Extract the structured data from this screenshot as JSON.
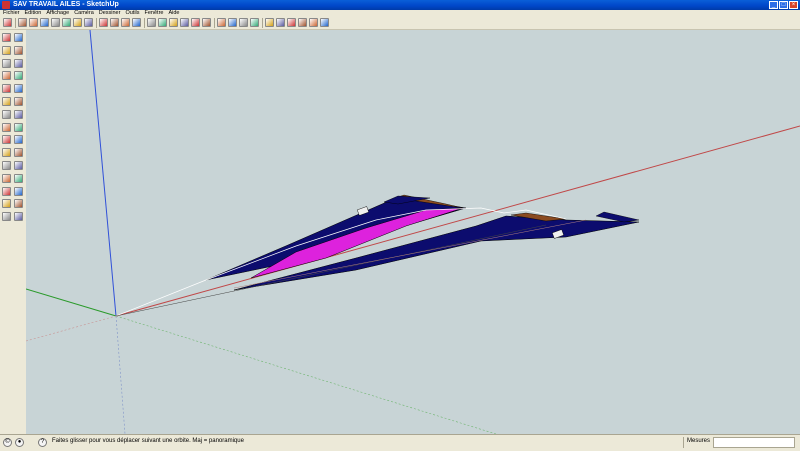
{
  "window": {
    "title": "SAV TRAVAIL AILES - SketchUp",
    "controls": [
      "minimize-icon",
      "maximize-icon",
      "close-icon"
    ]
  },
  "menu": {
    "items": [
      "Fichier",
      "Edition",
      "Affichage",
      "Caméra",
      "Dessiner",
      "Outils",
      "Fenêtre",
      "Aide"
    ]
  },
  "toolbar": {
    "icons": [
      "select-icon",
      "pencil-icon",
      "rectangle-icon",
      "circle-icon",
      "eraser-icon",
      "paint-bucket-icon",
      "tape-measure-icon",
      "push-pull-icon",
      "move-icon",
      "rotate-icon",
      "follow-me-icon",
      "offset-icon",
      "orbit-icon",
      "pan-icon",
      "zoom-icon",
      "zoom-extents-icon",
      "previous-view-icon",
      "next-view-icon",
      "position-camera-icon",
      "walk-icon",
      "look-around-icon",
      "section-plane-icon",
      "iso-view-icon",
      "top-view-icon",
      "front-view-icon",
      "right-view-icon",
      "back-view-icon",
      "left-view-icon"
    ]
  },
  "sidebar": {
    "icons": [
      "select-icon",
      "eraser-icon",
      "rectangle-icon",
      "pencil-icon",
      "circle-icon",
      "arc-icon",
      "polygon-icon",
      "freehand-icon",
      "move-icon",
      "push-pull-icon",
      "rotate-icon",
      "follow-me-icon",
      "scale-icon",
      "offset-icon",
      "tape-measure-icon",
      "dimension-icon",
      "protractor-icon",
      "text-icon",
      "axes-icon",
      "3d-text-icon",
      "orbit-icon",
      "pan-icon",
      "zoom-icon",
      "zoom-window-icon",
      "zoom-extents-icon",
      "previous-view-icon",
      "position-camera-icon",
      "look-around-icon",
      "walk-icon",
      "section-plane-icon"
    ]
  },
  "status": {
    "icons": [
      "credits-icon",
      "user-icon",
      "help-icon"
    ],
    "hint": "Faites glisser pour vous déplacer suivant une orbite. Maj = panoramique",
    "measure_label": "Mesures",
    "measure_value": ""
  },
  "colors": {
    "titlebar": "#0a5fd8",
    "viewport": "#c8d4d6",
    "wing_dark": "#0c0c6e",
    "wing_magenta": "#dd22dd",
    "wing_brown": "#8a4a20",
    "axis_red": "#c04848",
    "axis_green": "#2a9a2a",
    "axis_blue": "#3050d8"
  }
}
